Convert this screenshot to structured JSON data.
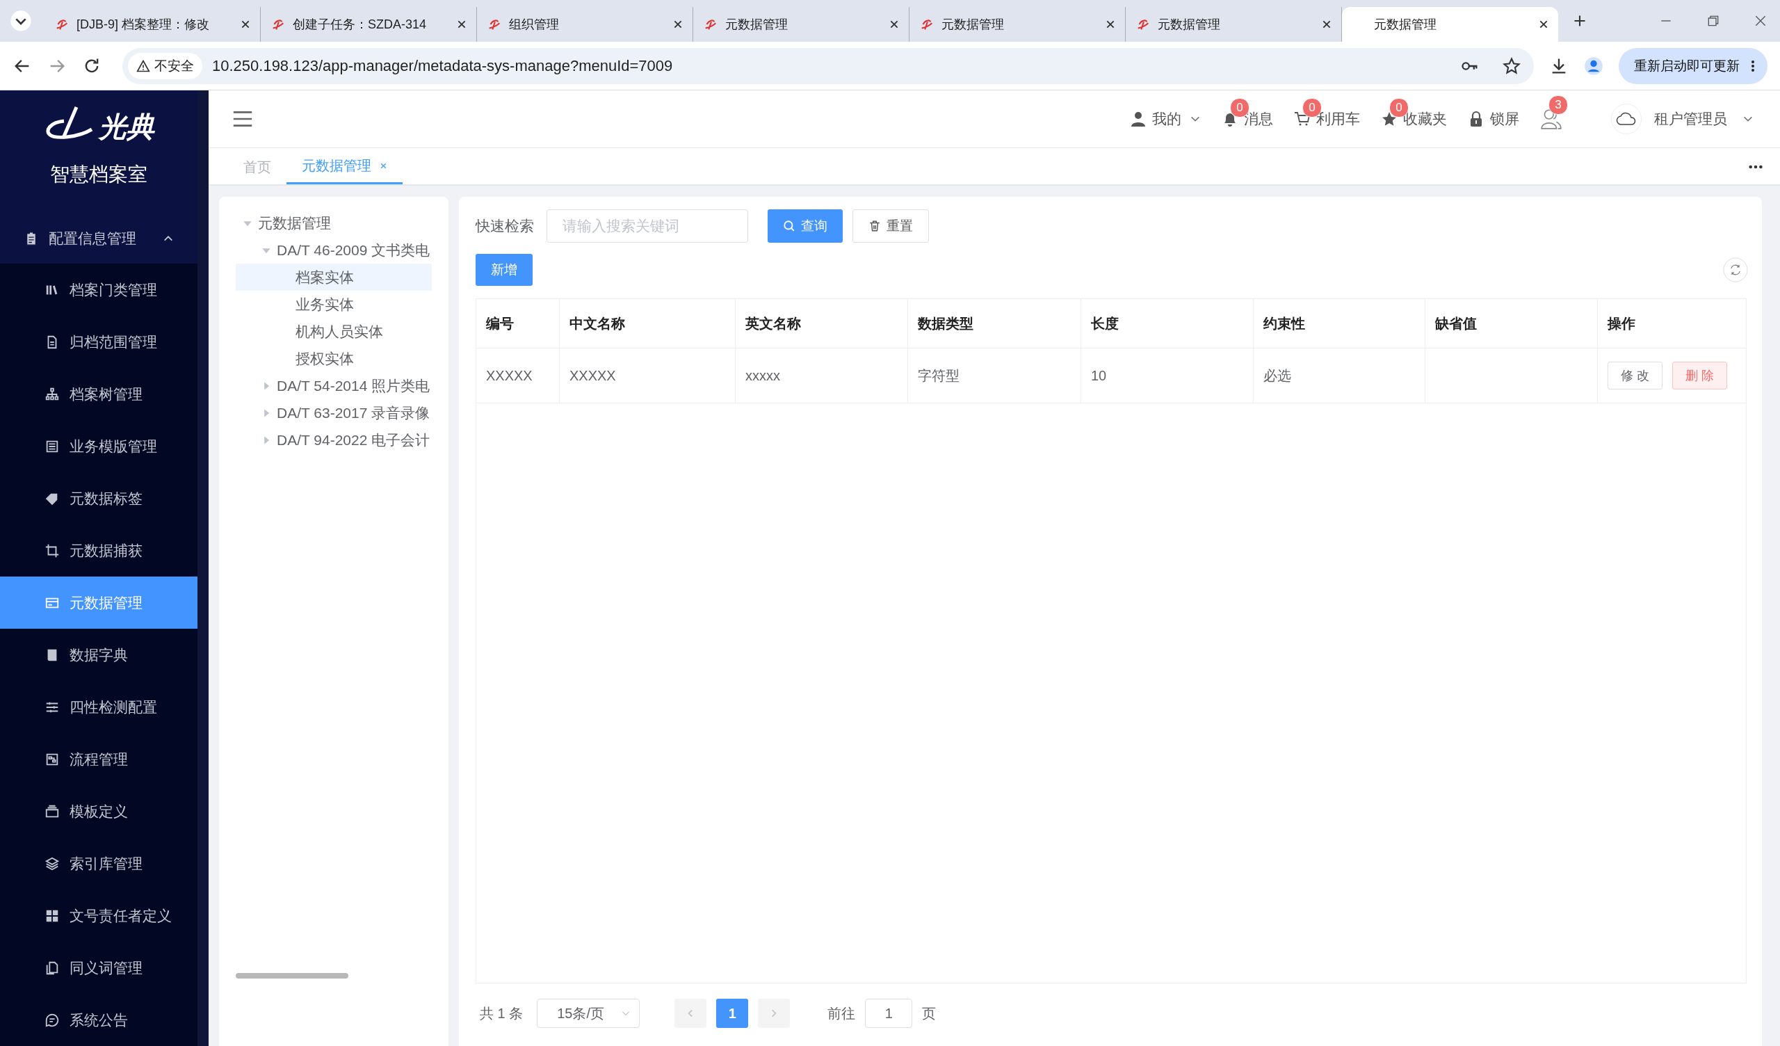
{
  "browser": {
    "tabs": [
      {
        "title": "[DJB-9] 档案整理：修改",
        "selected": false
      },
      {
        "title": "创建子任务：SZDA-314",
        "selected": false
      },
      {
        "title": "组织管理",
        "selected": false
      },
      {
        "title": "元数据管理",
        "selected": false
      },
      {
        "title": "元数据管理",
        "selected": false
      },
      {
        "title": "元数据管理",
        "selected": false
      },
      {
        "title": "元数据管理",
        "selected": true
      }
    ],
    "security_label": "不安全",
    "url": "10.250.198.123/app-manager/metadata-sys-manage?menuId=7009",
    "update_button": "重新启动即可更新"
  },
  "sidebar": {
    "logo_text": "光典",
    "subtitle": "智慧档案室",
    "group": {
      "label": "配置信息管理",
      "expanded": true
    },
    "items": [
      {
        "label": "档案门类管理",
        "selected": false
      },
      {
        "label": "归档范围管理",
        "selected": false
      },
      {
        "label": "档案树管理",
        "selected": false
      },
      {
        "label": "业务模版管理",
        "selected": false
      },
      {
        "label": "元数据标签",
        "selected": false
      },
      {
        "label": "元数据捕获",
        "selected": false
      },
      {
        "label": "元数据管理",
        "selected": true
      },
      {
        "label": "数据字典",
        "selected": false
      },
      {
        "label": "四性检测配置",
        "selected": false
      },
      {
        "label": "流程管理",
        "selected": false
      },
      {
        "label": "模板定义",
        "selected": false
      },
      {
        "label": "索引库管理",
        "selected": false
      },
      {
        "label": "文号责任者定义",
        "selected": false
      },
      {
        "label": "同义词管理",
        "selected": false
      },
      {
        "label": "系统公告",
        "selected": false
      }
    ]
  },
  "header": {
    "user_menu": "我的",
    "counters": [
      {
        "label": "消息",
        "count": "0"
      },
      {
        "label": "利用车",
        "count": "0"
      },
      {
        "label": "收藏夹",
        "count": "0"
      }
    ],
    "lock": "锁屏",
    "online_count": "3",
    "account": "租户管理员"
  },
  "page_tabs": [
    {
      "label": "首页",
      "selected": false,
      "closable": false
    },
    {
      "label": "元数据管理",
      "selected": true,
      "closable": true
    }
  ],
  "tree": [
    {
      "label": "元数据管理",
      "expanded": true,
      "selected": false,
      "children": [
        {
          "label": "DA/T 46-2009 文书类电",
          "expanded": true,
          "selected": false,
          "children": [
            {
              "label": "档案实体",
              "selected": true
            },
            {
              "label": "业务实体",
              "selected": false
            },
            {
              "label": "机构人员实体",
              "selected": false
            },
            {
              "label": "授权实体",
              "selected": false
            }
          ]
        },
        {
          "label": "DA/T 54-2014 照片类电",
          "expanded": false,
          "selected": false
        },
        {
          "label": "DA/T 63-2017 录音录像",
          "expanded": false,
          "selected": false
        },
        {
          "label": "DA/T 94-2022 电子会计",
          "expanded": false,
          "selected": false
        }
      ]
    }
  ],
  "search": {
    "label": "快速检索",
    "placeholder": "请输入搜索关键词",
    "search_button": "查询",
    "reset_button": "重置"
  },
  "add_button": "新增",
  "table": {
    "columns": [
      "编号",
      "中文名称",
      "英文名称",
      "数据类型",
      "长度",
      "约束性",
      "缺省值",
      "操作"
    ],
    "rows": [
      {
        "code": "XXXXX",
        "cn_name": "XXXXX",
        "en_name": "xxxxx",
        "data_type": "字符型",
        "length": "10",
        "constraint": "必选",
        "edit_button": "修 改",
        "delete_button": "删 除"
      }
    ]
  },
  "pagination": {
    "total": "共 1 条",
    "page_size": "15条/页",
    "pages": [
      {
        "label": "1",
        "selected": true
      }
    ],
    "goto_label": "前往",
    "goto_value": "1",
    "page_suffix": "页"
  }
}
